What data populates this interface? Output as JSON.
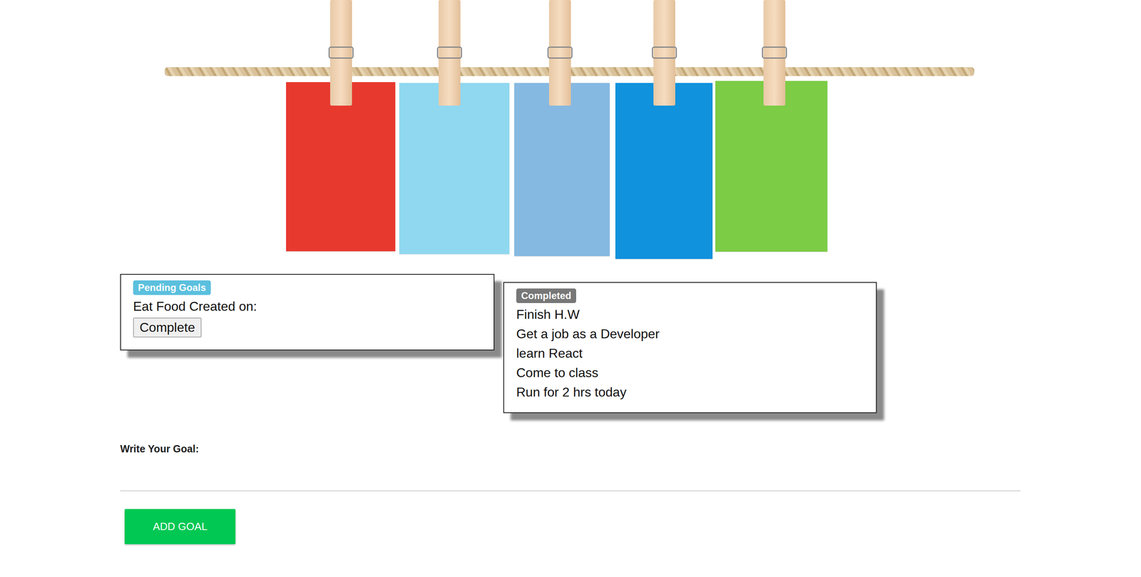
{
  "banner": {
    "cards": [
      {
        "color": "#e8392f"
      },
      {
        "color": "#8fd8f0"
      },
      {
        "color": "#86b9e2"
      },
      {
        "color": "#1192dc"
      },
      {
        "color": "#7ccc45"
      }
    ]
  },
  "pending": {
    "badge": "Pending Goals",
    "items": [
      {
        "text": "Eat Food Created on:",
        "button": "Complete"
      }
    ]
  },
  "completed": {
    "badge": "Completed",
    "items": [
      "Finish H.W",
      "Get a job as a Developer",
      "learn React",
      "Come to class",
      "Run for 2 hrs today"
    ]
  },
  "form": {
    "label": "Write Your Goal:",
    "button": "ADD GOAL"
  }
}
